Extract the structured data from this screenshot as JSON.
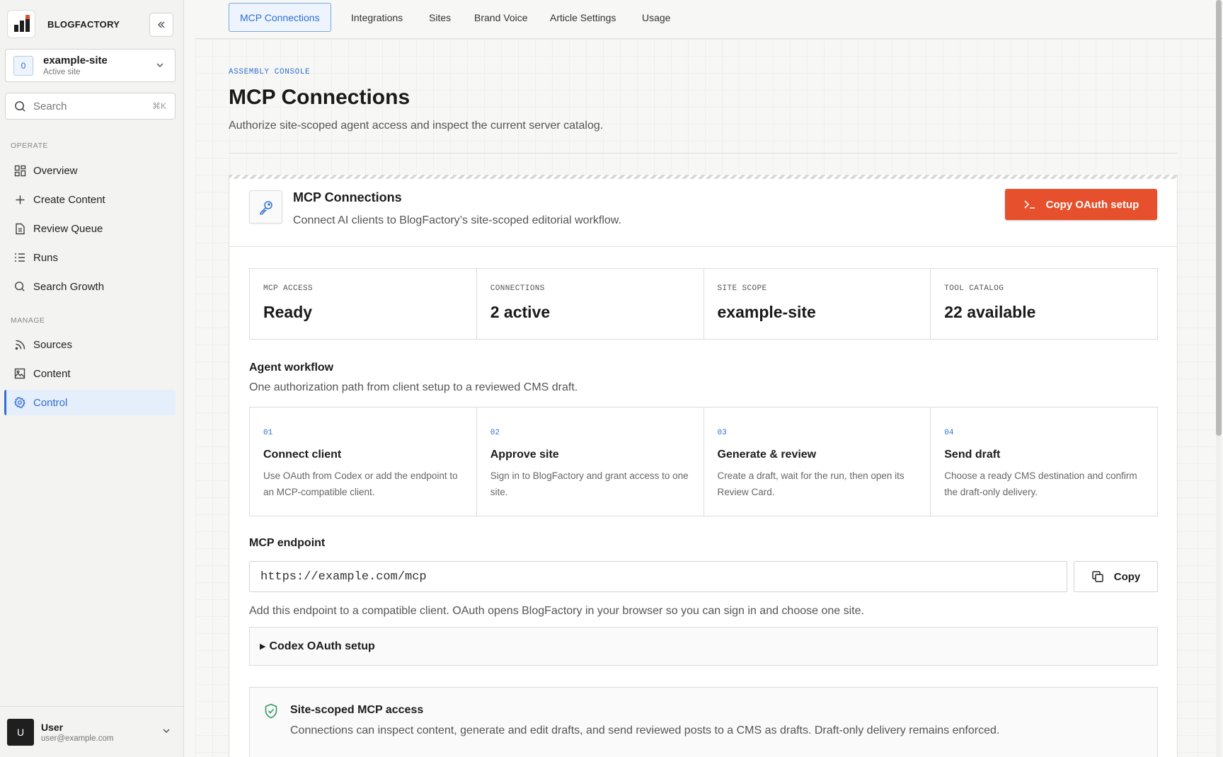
{
  "brand": {
    "name": "BLOGFACTORY"
  },
  "site_switcher": {
    "badge": "0",
    "name": "example-site",
    "status": "Active site"
  },
  "search": {
    "placeholder": "Search",
    "shortcut": "⌘K"
  },
  "nav": {
    "operate_label": "OPERATE",
    "operate": [
      {
        "label": "Overview",
        "icon": "grid-icon"
      },
      {
        "label": "Create Content",
        "icon": "plus-icon"
      },
      {
        "label": "Review Queue",
        "icon": "document-icon"
      },
      {
        "label": "Runs",
        "icon": "list-icon"
      },
      {
        "label": "Search Growth",
        "icon": "search-icon"
      }
    ],
    "manage_label": "MANAGE",
    "manage": [
      {
        "label": "Sources",
        "icon": "rss-icon"
      },
      {
        "label": "Content",
        "icon": "image-icon"
      },
      {
        "label": "Control",
        "icon": "gear-icon",
        "active": true
      }
    ]
  },
  "user": {
    "initial": "U",
    "name": "User",
    "email": "user@example.com"
  },
  "tabs": [
    "MCP Connections",
    "Integrations",
    "Sites",
    "Brand Voice",
    "Article Settings",
    "Usage"
  ],
  "header": {
    "eyebrow": "ASSEMBLY CONSOLE",
    "title": "MCP Connections",
    "subtitle": "Authorize site-scoped agent access and inspect the current server catalog."
  },
  "card": {
    "title": "MCP Connections",
    "subtitle": "Connect AI clients to BlogFactory’s site-scoped editorial workflow.",
    "oauth_button": "Copy OAuth setup"
  },
  "stats": [
    {
      "label": "MCP ACCESS",
      "value": "Ready"
    },
    {
      "label": "CONNECTIONS",
      "value": "2 active"
    },
    {
      "label": "SITE SCOPE",
      "value": "example-site"
    },
    {
      "label": "TOOL CATALOG",
      "value": "22 available"
    }
  ],
  "workflow": {
    "title": "Agent workflow",
    "subtitle": "One authorization path from client setup to a reviewed CMS draft.",
    "steps": [
      {
        "num": "01",
        "title": "Connect client",
        "desc": "Use OAuth from Codex or add the endpoint to an MCP-compatible client."
      },
      {
        "num": "02",
        "title": "Approve site",
        "desc": "Sign in to BlogFactory and grant access to one site."
      },
      {
        "num": "03",
        "title": "Generate & review",
        "desc": "Create a draft, wait for the run, then open its Review Card."
      },
      {
        "num": "04",
        "title": "Send draft",
        "desc": "Choose a ready CMS destination and confirm the draft-only delivery."
      }
    ]
  },
  "endpoint": {
    "title": "MCP endpoint",
    "url": "https://example.com/mcp",
    "copy_label": "Copy",
    "help": "Add this endpoint to a compatible client. OAuth opens BlogFactory in your browser so you can sign in and choose one site.",
    "details_label": "Codex OAuth setup"
  },
  "scope": {
    "title": "Site-scoped MCP access",
    "desc": "Connections can inspect content, generate and edit drafts, and send reviewed posts to a CMS as drafts. Draft-only delivery remains enforced."
  },
  "colors": {
    "accent": "#2f6fd0",
    "cta": "#e6502c",
    "success": "#2e9b5f"
  }
}
